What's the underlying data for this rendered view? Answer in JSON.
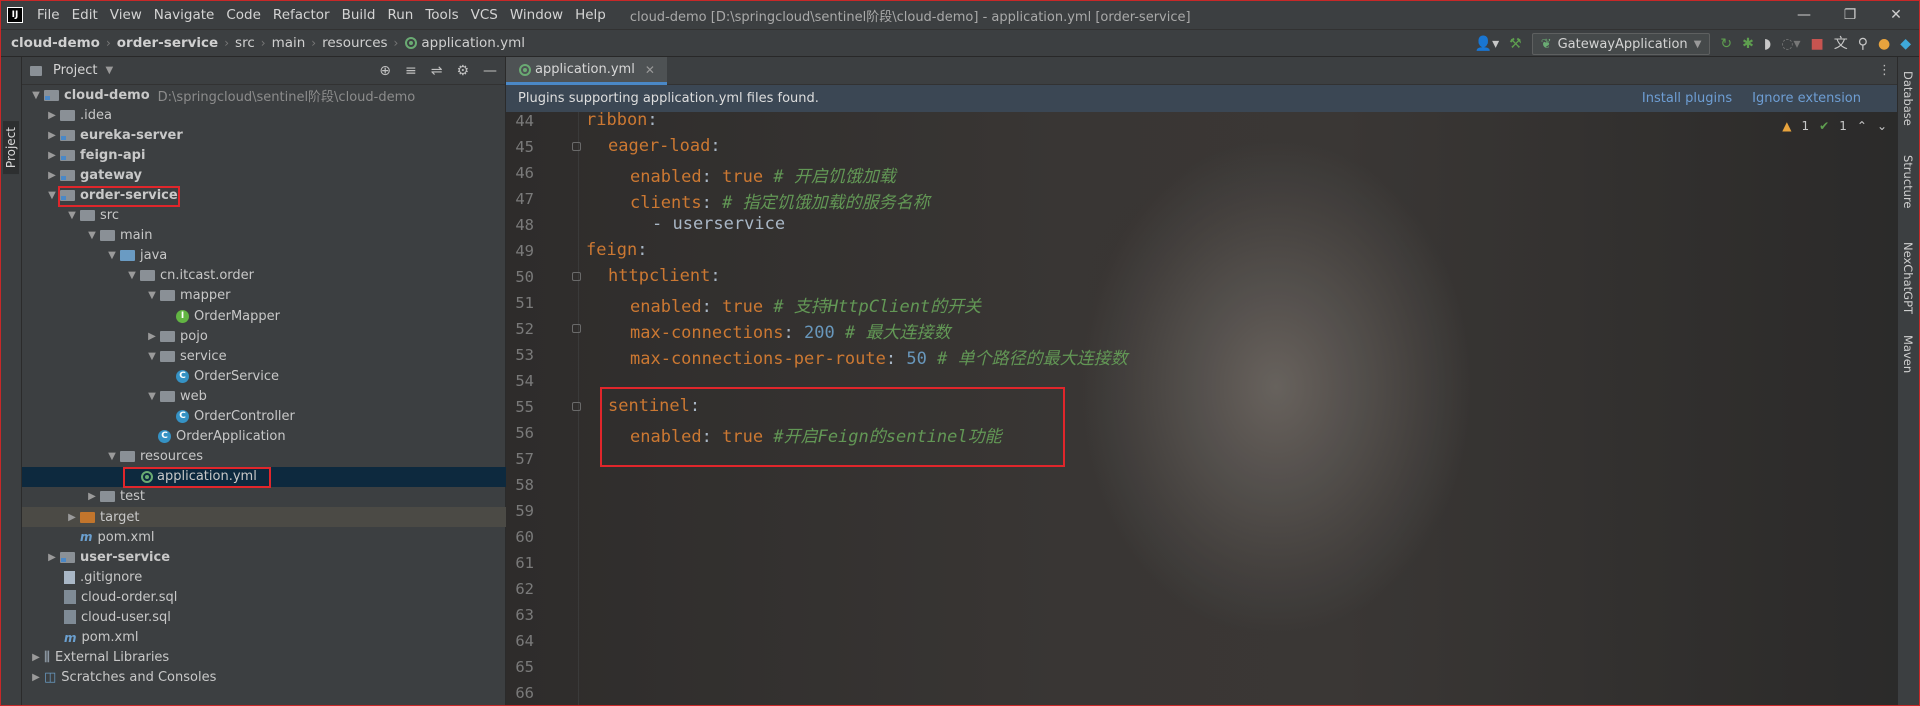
{
  "titlebar": {
    "app_logo": "IJ",
    "menu": [
      "File",
      "Edit",
      "View",
      "Navigate",
      "Code",
      "Refactor",
      "Build",
      "Run",
      "Tools",
      "VCS",
      "Window",
      "Help"
    ],
    "window_title": "cloud-demo [D:\\springcloud\\sentinel阶段\\cloud-demo] - application.yml [order-service]",
    "controls": [
      "—",
      "❐",
      "✕"
    ]
  },
  "breadcrumb": [
    "cloud-demo",
    "order-service",
    "src",
    "main",
    "resources",
    "application.yml"
  ],
  "toolbar": {
    "run_config": "GatewayApplication"
  },
  "left_stripe": {
    "project_label": "Project"
  },
  "project_panel": {
    "title": "Project",
    "tree": [
      {
        "label": "cloud-demo",
        "extra": "D:\\springcloud\\sentinel阶段\\cloud-demo"
      },
      {
        "label": ".idea"
      },
      {
        "label": "eureka-server"
      },
      {
        "label": "feign-api"
      },
      {
        "label": "gateway"
      },
      {
        "label": "order-service"
      },
      {
        "label": "src"
      },
      {
        "label": "main"
      },
      {
        "label": "java"
      },
      {
        "label": "cn.itcast.order"
      },
      {
        "label": "mapper"
      },
      {
        "label": "OrderMapper"
      },
      {
        "label": "pojo"
      },
      {
        "label": "service"
      },
      {
        "label": "OrderService"
      },
      {
        "label": "web"
      },
      {
        "label": "OrderController"
      },
      {
        "label": "OrderApplication"
      },
      {
        "label": "resources"
      },
      {
        "label": "application.yml"
      },
      {
        "label": "test"
      },
      {
        "label": "target"
      },
      {
        "label": "pom.xml"
      },
      {
        "label": "user-service"
      },
      {
        "label": ".gitignore"
      },
      {
        "label": "cloud-order.sql"
      },
      {
        "label": "cloud-user.sql"
      },
      {
        "label": "pom.xml"
      },
      {
        "label": "External Libraries"
      },
      {
        "label": "Scratches and Consoles"
      }
    ]
  },
  "editor": {
    "tab": "application.yml",
    "banner": {
      "message": "Plugins supporting application.yml files found.",
      "install": "Install plugins",
      "ignore": "Ignore extension"
    },
    "inspections": {
      "warnings": "1",
      "ok": "1"
    },
    "line_numbers": [
      "44",
      "45",
      "46",
      "47",
      "48",
      "49",
      "50",
      "51",
      "52",
      "53",
      "54",
      "55",
      "56",
      "57",
      "58",
      "59",
      "60",
      "61",
      "62",
      "63",
      "64",
      "65",
      "66"
    ],
    "lines": {
      "l44_key": "ribbon",
      "l45_key": "eager-load",
      "l46_key": "enabled",
      "l46_val": "true",
      "l46_comment": "# 开启饥饿加载",
      "l47_key": "clients",
      "l47_comment": "# 指定饥饿加载的服务名称",
      "l48_item": "- userservice",
      "l49_key": "feign",
      "l50_key": "httpclient",
      "l51_key": "enabled",
      "l51_val": "true",
      "l51_comment": "# 支持HttpClient的开关",
      "l52_key": "max-connections",
      "l52_val": "200",
      "l52_comment": "# 最大连接数",
      "l53_key": "max-connections-per-route",
      "l53_val": "50",
      "l53_comment": "# 单个路径的最大连接数",
      "l55_key": "sentinel",
      "l56_key": "enabled",
      "l56_val": "true",
      "l56_comment": "#开启Feign的sentinel功能"
    }
  },
  "right_stripe": [
    "Database",
    "Structure",
    "NexChatGPT",
    "Maven"
  ],
  "colors": {
    "highlight_box": "#e0262b",
    "selection": "#0d293e",
    "link": "#6e9ed4"
  }
}
